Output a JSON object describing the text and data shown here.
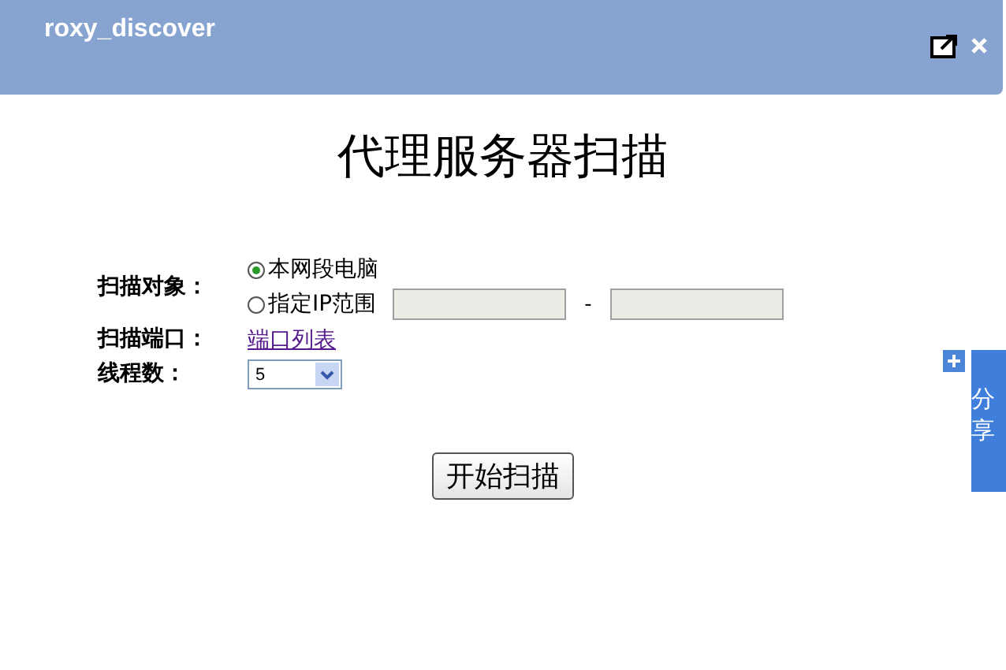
{
  "window": {
    "title": "roxy_discover"
  },
  "heading": "代理服务器扫描",
  "scan_target": {
    "label": "扫描对象：",
    "options": [
      {
        "kind": "plain",
        "label": "本网段电脑",
        "selected": true
      },
      {
        "kind": "range",
        "label": "指定IP范围",
        "selected": false,
        "separator": "-"
      }
    ]
  },
  "scan_port": {
    "label": "扫描端口：",
    "link": "端口列表"
  },
  "threads": {
    "label": "线程数：",
    "value": "5"
  },
  "start_button": "开始扫描",
  "share": {
    "label": "分享"
  }
}
